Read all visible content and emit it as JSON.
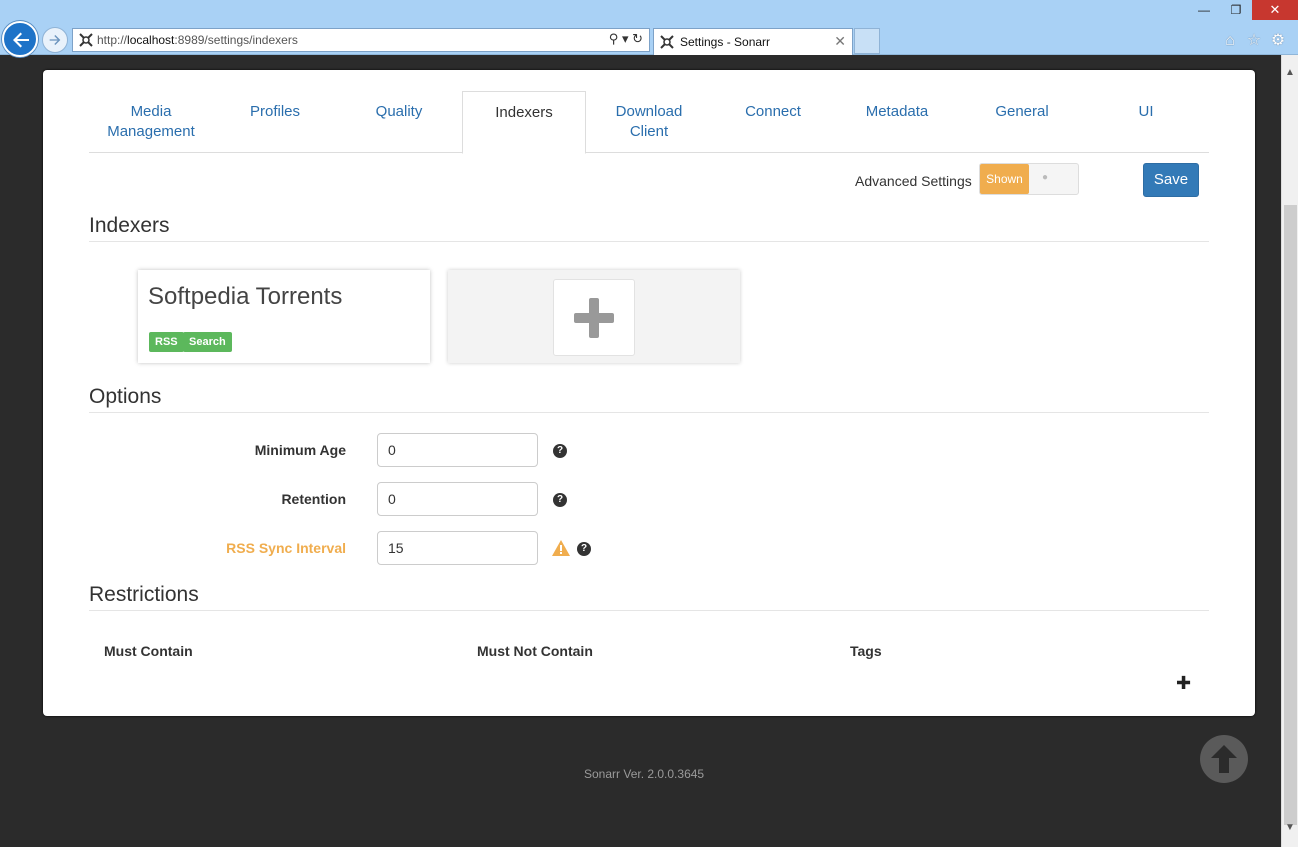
{
  "browser": {
    "url_prefix": "http://",
    "url_host": "localhost",
    "url_rest": ":8989/settings/indexers",
    "tab_title": "Settings - Sonarr",
    "tab_close": "✕"
  },
  "nav_tabs": [
    {
      "label": "Media\nManagement"
    },
    {
      "label": "Profiles"
    },
    {
      "label": "Quality"
    },
    {
      "label": "Indexers"
    },
    {
      "label": "Download\nClient"
    },
    {
      "label": "Connect"
    },
    {
      "label": "Metadata"
    },
    {
      "label": "General"
    },
    {
      "label": "UI"
    }
  ],
  "advanced": {
    "label": "Advanced Settings",
    "toggle_on": "Shown"
  },
  "save_label": "Save",
  "sections": {
    "indexers": "Indexers",
    "options": "Options",
    "restrictions": "Restrictions"
  },
  "indexer_card": {
    "name": "Softpedia Torrents",
    "badges": [
      "RSS",
      "Search"
    ]
  },
  "options": {
    "min_age_label": "Minimum Age",
    "min_age_value": "0",
    "retention_label": "Retention",
    "retention_value": "0",
    "rss_label": "RSS Sync Interval",
    "rss_value": "15",
    "help_glyph": "?"
  },
  "restrictions": {
    "must_contain": "Must Contain",
    "must_not_contain": "Must Not Contain",
    "tags": "Tags"
  },
  "footer": {
    "version": "Sonarr Ver. 2.0.0.3645"
  },
  "colors": {
    "primary": "#337ab7",
    "warning": "#f0ad4e",
    "success": "#5cb85c",
    "link": "#2a6ead"
  }
}
